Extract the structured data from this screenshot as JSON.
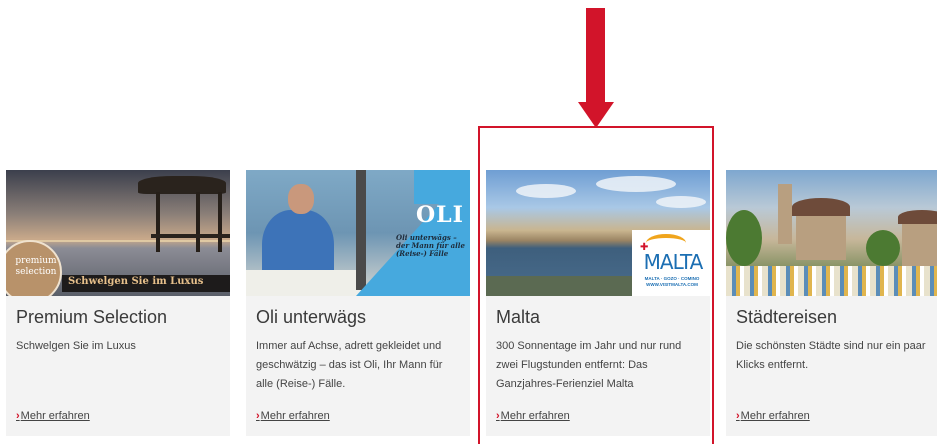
{
  "colors": {
    "accent": "#d2142a",
    "card_bg": "#f3f3f3",
    "text": "#3a3a3a"
  },
  "cards": [
    {
      "title": "Premium Selection",
      "description": "Schwelgen Sie im Luxus",
      "link": "Mehr erfahren",
      "image_badge": "premium selection",
      "image_banner": "Schwelgen Sie im Luxus"
    },
    {
      "title": "Oli unterwägs",
      "description": "Immer auf Achse, adrett gekleidet und geschwätzig – das ist Oli, Ihr Mann für alle (Reise-) Fälle.",
      "link": "Mehr erfahren",
      "image_logo": "OLI",
      "image_tagline": "Oli unterwägs – der Mann für alle (Reise-) Fälle"
    },
    {
      "title": "Malta",
      "description": "300 Sonnentage im Jahr und nur rund zwei Flugstunden entfernt: Das Ganzjahres-Ferienziel Malta",
      "link": "Mehr erfahren",
      "image_logo": "MALTA",
      "image_logo_sub": "MALTA · GOZO · COMINO",
      "image_logo_url": "WWW.VISITMALTA.COM"
    },
    {
      "title": "Städtereisen",
      "description": "Die schönsten Städte sind nur ein paar Klicks entfernt.",
      "link": "Mehr erfahren"
    }
  ],
  "link_chevron": "›"
}
